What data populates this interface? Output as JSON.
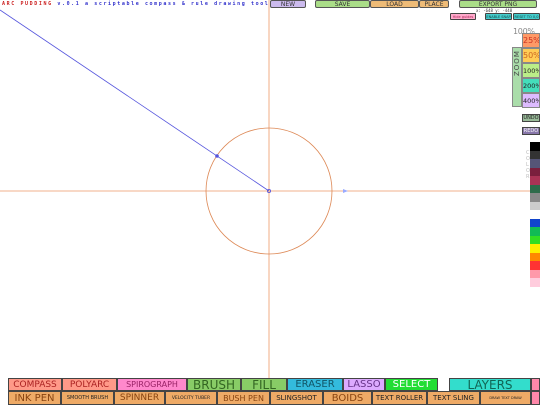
{
  "header": {
    "app_name": "ARC PUDDING",
    "version_tagline": "v.0.1  a  scriptable  compass  &  rule  drawing  tool"
  },
  "top_menu": {
    "new": "NEW",
    "save": "SAVE",
    "load": "LOAD",
    "place": "PLACE",
    "export": "EXPORT PNG"
  },
  "coords": "x: -648  y: -448",
  "guides": {
    "hide_guides": "Hide guides",
    "snap": "ENABLE SNAP",
    "reset": "RESET TO 0,0"
  },
  "zoom": {
    "current": "100%",
    "vertical_label": "ZOOM",
    "levels": [
      "25%",
      "50%",
      "100%",
      "200%",
      "400%"
    ]
  },
  "history": {
    "undo": "UNDO",
    "redo": "REDO"
  },
  "colors": {
    "label": "COLOR",
    "palette": [
      "#000000",
      "#333333",
      "#555577",
      "#7a1f3d",
      "#aa3355",
      "#2e6b4a",
      "#888888",
      "#cccccc",
      "#ffffff",
      "#1144cc",
      "#11bb55",
      "#33dd22",
      "#ffee00",
      "#ff8800",
      "#ff3333",
      "#ff99aa",
      "#ffccdd"
    ]
  },
  "tools_row1": [
    {
      "label": "COMPASS",
      "color": "#ff9988",
      "text": "#aa2222"
    },
    {
      "label": "POLYARC",
      "color": "#ff9988",
      "text": "#aa2222"
    },
    {
      "label": "SPIROGRAPH",
      "color": "#ff88cc",
      "text": "#992266"
    },
    {
      "label": "BRUSH",
      "color": "#88cc66",
      "text": "#336622"
    },
    {
      "label": "FILL",
      "color": "#88cc66",
      "text": "#336622"
    },
    {
      "label": "ERASER",
      "color": "#33bbdd",
      "text": "#115566"
    },
    {
      "label": "LASSO",
      "color": "#ddaaff",
      "text": "#663388"
    },
    {
      "label": "SELECT",
      "color": "#22dd33",
      "text": "#ffffff"
    },
    {
      "label": "LAYERS",
      "color": "#33ddcc",
      "text": "#116655"
    },
    {
      "label": "",
      "color": "#ff88aa",
      "text": "#222222"
    }
  ],
  "tools_row2": [
    {
      "label": "INK PEN",
      "color": "#eeaa66",
      "text": "#884411"
    },
    {
      "label": "SMOOTH BRUSH",
      "color": "#eeaa66",
      "text": "#222222"
    },
    {
      "label": "SPINNER",
      "color": "#eeaa66",
      "text": "#884411"
    },
    {
      "label": "VELOCITY TUBER",
      "color": "#eeaa66",
      "text": "#222222"
    },
    {
      "label": "BUSH PEN",
      "color": "#eeaa66",
      "text": "#884411"
    },
    {
      "label": "SLINGSHOT",
      "color": "#eeaa66",
      "text": "#222222"
    },
    {
      "label": "BOIDS",
      "color": "#eeaa66",
      "text": "#884411"
    },
    {
      "label": "TEXT ROLLER",
      "color": "#eeaa66",
      "text": "#222222"
    },
    {
      "label": "TEXT SLING",
      "color": "#eeaa66",
      "text": "#222222"
    },
    {
      "label": "DRAW TEXT DRAW",
      "color": "#eeaa66",
      "text": "#222222"
    },
    {
      "label": "",
      "color": "#ff88aa",
      "text": "#222222"
    }
  ]
}
